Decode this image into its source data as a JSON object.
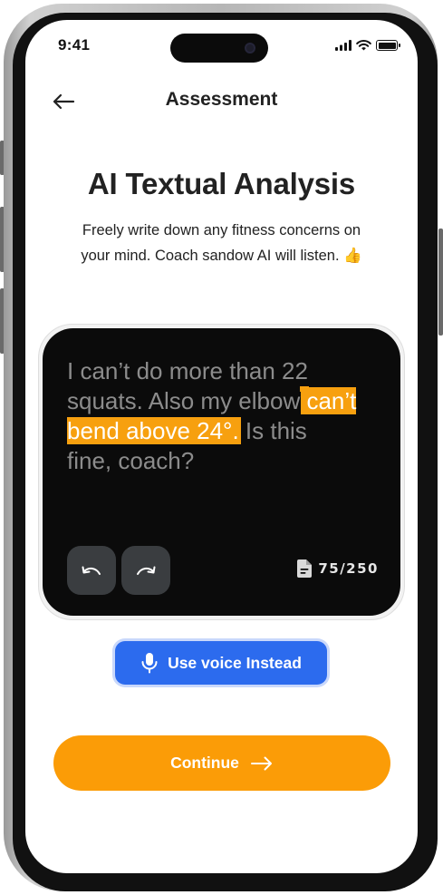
{
  "status_bar": {
    "time": "9:41"
  },
  "nav": {
    "title": "Assessment",
    "back_icon": "arrow-left-icon"
  },
  "header": {
    "title": "AI Textual Analysis",
    "subtitle_line1": "Freely write down any fitness concerns on",
    "subtitle_line2": "your mind. Coach sandow AI will listen. 👍"
  },
  "editor": {
    "text_before": "I can’t do more than 22 squats. Also my elbow ",
    "text_highlighted": "can’t bend above 24°.",
    "text_after": " Is this fine, coach?",
    "undo_icon": "undo-icon",
    "redo_icon": "redo-icon",
    "counter_icon": "document-icon",
    "char_count": "75/250"
  },
  "voice": {
    "label": "Use voice Instead",
    "icon": "microphone-icon"
  },
  "continue": {
    "label": "Continue",
    "icon": "arrow-right-icon"
  },
  "colors": {
    "accent_orange": "#fb9c07",
    "highlight_orange": "#f7a00f",
    "voice_blue": "#2c6bee",
    "card_black": "#0b0b0b"
  }
}
